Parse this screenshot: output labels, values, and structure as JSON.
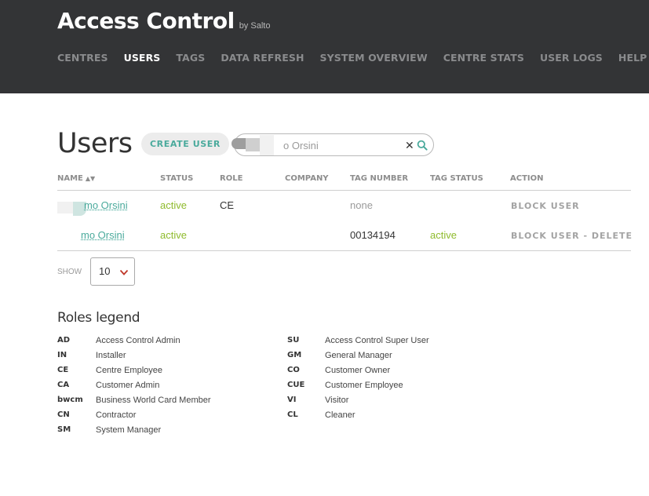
{
  "brand": {
    "title": "Access Control",
    "by": "by Salto"
  },
  "nav": [
    {
      "label": "CENTRES",
      "active": false
    },
    {
      "label": "USERS",
      "active": true
    },
    {
      "label": "TAGS",
      "active": false
    },
    {
      "label": "DATA REFRESH",
      "active": false
    },
    {
      "label": "SYSTEM OVERVIEW",
      "active": false
    },
    {
      "label": "CENTRE STATS",
      "active": false
    },
    {
      "label": "USER LOGS",
      "active": false
    },
    {
      "label": "HELP",
      "active": false
    }
  ],
  "page": {
    "title": "Users",
    "create_label": "CREATE USER"
  },
  "search": {
    "value": "o Orsini",
    "clear_glyph": "✕"
  },
  "table": {
    "headers": {
      "name": "NAME",
      "status": "STATUS",
      "role": "ROLE",
      "company": "COMPANY",
      "tag_number": "TAG NUMBER",
      "tag_status": "TAG STATUS",
      "action": "ACTION"
    },
    "rows": [
      {
        "name": "mo Orsini",
        "status": "active",
        "role": "CE",
        "company": "",
        "tag_number": "none",
        "tag_status": "",
        "action": "BLOCK USER"
      },
      {
        "name": "mo Orsini",
        "status": "active",
        "role": "",
        "company": "",
        "tag_number": "00134194",
        "tag_status": "active",
        "action": "BLOCK USER - DELETE"
      }
    ]
  },
  "pagination": {
    "show_label": "SHOW",
    "page_size": "10"
  },
  "legend": {
    "title": "Roles legend",
    "left": [
      {
        "code": "AD",
        "desc": "Access Control Admin"
      },
      {
        "code": "IN",
        "desc": "Installer"
      },
      {
        "code": "CE",
        "desc": "Centre Employee"
      },
      {
        "code": "CA",
        "desc": "Customer Admin"
      },
      {
        "code": "bwcm",
        "desc": "Business World Card Member"
      },
      {
        "code": "CN",
        "desc": "Contractor"
      },
      {
        "code": "SM",
        "desc": "System Manager"
      }
    ],
    "right": [
      {
        "code": "SU",
        "desc": "Access Control Super User"
      },
      {
        "code": "GM",
        "desc": "General Manager"
      },
      {
        "code": "CO",
        "desc": "Customer Owner"
      },
      {
        "code": "CUE",
        "desc": "Customer Employee"
      },
      {
        "code": "VI",
        "desc": "Visitor"
      },
      {
        "code": "CL",
        "desc": "Cleaner"
      }
    ]
  },
  "colors": {
    "header_bg": "#333436",
    "accent": "#4aaa9c",
    "active_green": "#8fbb2c"
  }
}
